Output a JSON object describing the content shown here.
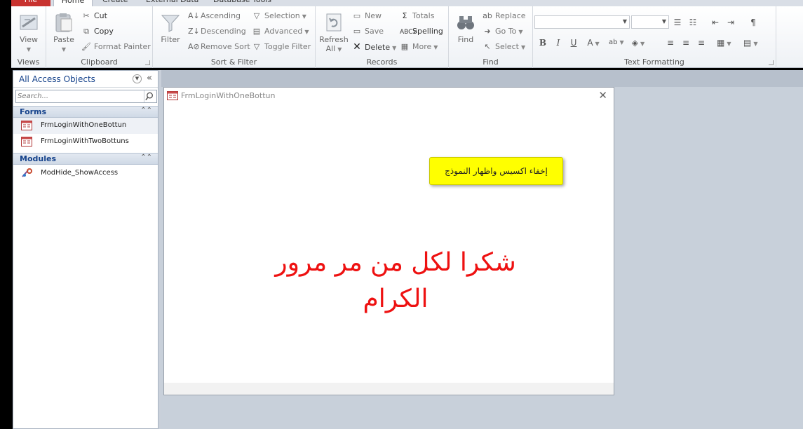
{
  "ribbon_tabs": [
    "File",
    "Home",
    "Create",
    "External Data",
    "Database Tools"
  ],
  "groups": {
    "views": {
      "label": "Views",
      "view": "View"
    },
    "clipboard": {
      "label": "Clipboard",
      "paste": "Paste",
      "cut": "Cut",
      "copy": "Copy",
      "format_painter": "Format Painter"
    },
    "sort_filter": {
      "label": "Sort & Filter",
      "filter": "Filter",
      "ascending": "Ascending",
      "descending": "Descending",
      "remove_sort": "Remove Sort",
      "selection": "Selection",
      "advanced": "Advanced",
      "toggle_filter": "Toggle Filter"
    },
    "records": {
      "label": "Records",
      "refresh_all_1": "Refresh",
      "refresh_all_2": "All",
      "new": "New",
      "save": "Save",
      "delete": "Delete",
      "totals": "Totals",
      "spelling": "Spelling",
      "more": "More"
    },
    "find": {
      "label": "Find",
      "find": "Find",
      "replace": "Replace",
      "goto": "Go To",
      "select": "Select"
    },
    "text_formatting": {
      "label": "Text Formatting",
      "bold": "B",
      "italic": "I",
      "underline": "U"
    }
  },
  "nav": {
    "title": "All Access Objects",
    "search_placeholder": "Search...",
    "sections": [
      {
        "label": "Forms",
        "items": [
          "FrmLoginWithOneBottun",
          "FrmLoginWithTwoBottuns"
        ]
      },
      {
        "label": "Modules",
        "items": [
          "ModHide_ShowAccess"
        ]
      }
    ]
  },
  "form": {
    "title": "FrmLoginWithOneBottun",
    "button_label": "إخفاء اكسيس واظهار النموذج",
    "thanks_line1": "شكرا لكل من مر مرور",
    "thanks_line2": "الكرام"
  },
  "colors": {
    "accent_file": "#c8322f",
    "button_bg": "#ffff00",
    "thanks_text": "#ee1111",
    "nav_heading": "#15428b"
  }
}
